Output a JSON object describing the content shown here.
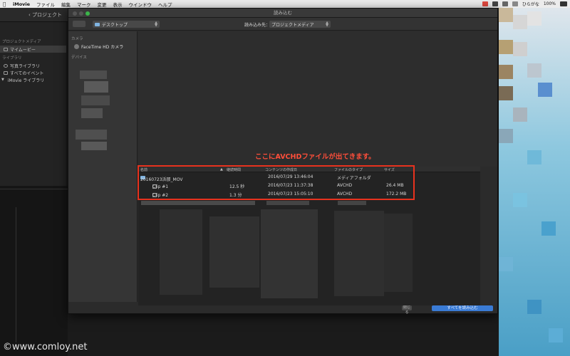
{
  "menubar": {
    "items": [
      "iMovie",
      "ファイル",
      "編集",
      "マーク",
      "変更",
      "表示",
      "ウインドウ",
      "ヘルプ"
    ],
    "right_user": "ひらがな",
    "battery": "100%"
  },
  "imovie": {
    "back_label": "プロジェクト",
    "sidebar": {
      "project_header": "プロジェクトメディア",
      "project_item": "マイムービー",
      "library_header": "ライブラリ",
      "library_items": [
        "写真ライブラリ",
        "すべてのイベント",
        "iMovie ライブラリ"
      ]
    }
  },
  "dialog": {
    "title": "読み込む",
    "location": "デスクトップ",
    "import_label": "読み込み先：",
    "import_target": "プロジェクトメディア",
    "left": {
      "camera_header": "カメラ",
      "camera_item": "FaceTime HD カメラ",
      "device_header": "デバイス"
    },
    "annotation": "ここにAVCHDファイルが出てきます。",
    "columns": [
      "名前",
      "継続時間",
      "コンテンツの作成日",
      "ファイルのタイプ",
      "サイズ"
    ],
    "rows": [
      {
        "name": "20160723浜那_MOV",
        "duration": "",
        "date": "2016/07/29 13:46:04",
        "type": "メディアフォルダ",
        "size": ""
      },
      {
        "name": "Clip #1",
        "duration": "12.5 秒",
        "date": "2016/07/23 11:37:38",
        "type": "AVCHD",
        "size": "26.4 MB"
      },
      {
        "name": "Clip #2",
        "duration": "1.3 分",
        "date": "2016/07/23 15:05:10",
        "type": "AVCHD",
        "size": "172.2 MB"
      }
    ],
    "close_button": "閉じる",
    "import_all_button": "すべてを読み込む"
  },
  "watermark": "©www.comloy.net",
  "colors": {
    "highlight": "#e8321e",
    "annotation": "#ff4e3a",
    "primary_button": "#3a7bd5"
  }
}
